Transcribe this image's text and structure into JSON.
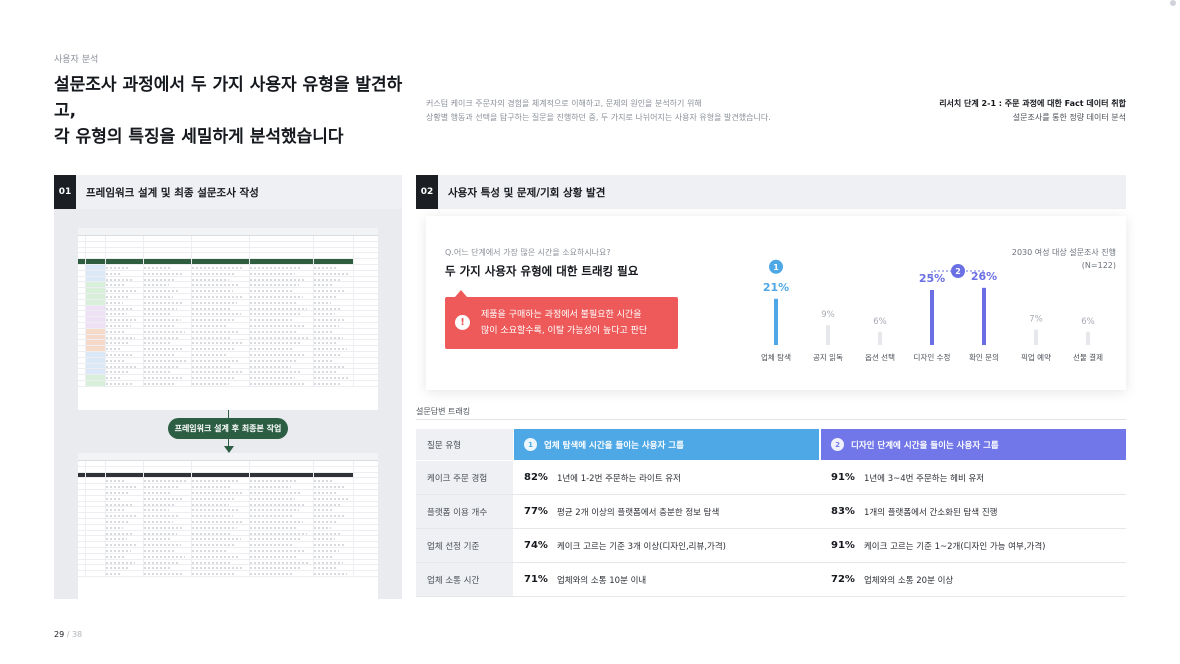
{
  "header": {
    "section_label": "사용자 분석",
    "title_line1": "설문조사 과정에서 두 가지 사용자 유형을 발견하고,",
    "title_line2": "각 유형의 특징을 세밀하게 분석했습니다",
    "desc_line1": "커스텀 케이크 주문자의 경험을 체계적으로 이해하고, 문제의 원인을 분석하기 위해",
    "desc_line2": "상황별 행동과 선택을 탐구하는 질문을 진행하던 중, 두 가지로 나뉘어지는 사용자 유형을 발견했습니다.",
    "step_line1": "리서치 단계 2-1 : 주문 과정에 대한 Fact 데이터 취합",
    "step_line2": "설문조사를 통한 정량 데이터 분석"
  },
  "panel1": {
    "num": "01",
    "title": "프레임워크 설계 및 최종 설문조사 작성",
    "connector_label": "프레임워크 설계 후 최종본 작업"
  },
  "panel2": {
    "num": "02",
    "title": "사용자 특성 및 문제/기회 상황 발견",
    "question": "Q.어느 단계에서 가장 많은 시간을 소요하시나요?",
    "question_title": "두 가지 사용자 유형에 대한 트래킹 필요",
    "survey_line1": "2030 여성 대상 설문조사 진행",
    "survey_line2": "(N=122)",
    "callout_line1": "제품을 구매하는 과정에서 불필요한 시간을",
    "callout_line2": "많이 소요할수록, 이탈 가능성이 높다고 판단",
    "callout_icon": "!"
  },
  "chart_data": {
    "type": "bar",
    "categories": [
      "업체 탐색",
      "공지 읽독",
      "옵션 선택",
      "디자인 수정",
      "확인 문의",
      "픽업 예약",
      "선물 결제"
    ],
    "values": [
      21,
      9,
      6,
      25,
      26,
      7,
      6
    ],
    "value_labels": [
      "21%",
      "9%",
      "6%",
      "25%",
      "26%",
      "7%",
      "6%"
    ],
    "markers": [
      {
        "label": "1",
        "category": "업체 탐색"
      },
      {
        "label": "2",
        "categories": [
          "디자인 수정",
          "확인 문의"
        ]
      }
    ],
    "highlight": {
      "업체 탐색": "#4ea8e6",
      "디자인 수정": "#6a6fe3",
      "확인 문의": "#6a6fe3"
    },
    "base_color": "#e6e8eb",
    "ylim": [
      0,
      30
    ]
  },
  "table": {
    "caption": "설문답변 트래킹",
    "col_question": "질문 유형",
    "group1": {
      "num": "1",
      "label": "업체 탐색에 시간을 들이는 사용자 그룹",
      "color": "#4ea8e6"
    },
    "group2": {
      "num": "2",
      "label": "디자인 단계에 시간을 들이는 사용자 그룹",
      "color": "#7176e8"
    },
    "rows": [
      {
        "q": "케이크 주문 경험",
        "p1": "82%",
        "t1": "1년에 1-2번 주문하는 라이트 유저",
        "p2": "91%",
        "t2": "1년에 3~4번 주문하는 헤비 유저"
      },
      {
        "q": "플랫폼 이용 개수",
        "p1": "77%",
        "t1": "평균 2개 이상의 플랫폼에서 충분한 정보 탐색",
        "p2": "83%",
        "t2": "1개의 플랫폼에서 간소화된 탐색 진행"
      },
      {
        "q": "업체 선정 기준",
        "p1": "74%",
        "t1": "케이크 고르는 기준 3개 이상(디자인,리뷰,가격)",
        "p2": "91%",
        "t2": "케이크 고르는 기준 1~2개(디자인 가능 여부,가격)"
      },
      {
        "q": "업체 소통 시간",
        "p1": "71%",
        "t1": "업체와의 소통 10분 이내",
        "p2": "72%",
        "t2": "업체와의 소통 20분 이상"
      }
    ]
  },
  "footer": {
    "page": "29",
    "separator": " / ",
    "total": "38"
  }
}
